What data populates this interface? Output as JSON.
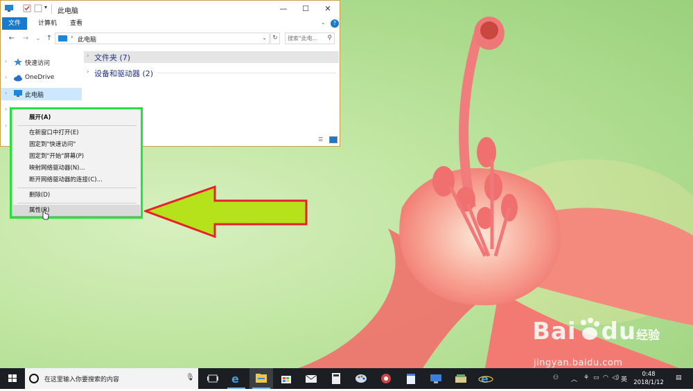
{
  "explorer": {
    "title": "此电脑",
    "tabs": [
      {
        "label": "文件",
        "active": true
      },
      {
        "label": "计算机",
        "active": false
      },
      {
        "label": "查看",
        "active": false
      }
    ],
    "address": {
      "path": "此电脑"
    },
    "search": {
      "placeholder": "搜索\"此电...",
      "icon": "search-icon"
    },
    "nav_pane": [
      {
        "label": "快速访问",
        "icon": "star-icon"
      },
      {
        "label": "OneDrive",
        "icon": "cloud-icon"
      },
      {
        "label": "此电脑",
        "icon": "computer-icon",
        "selected": true
      }
    ],
    "groups": [
      {
        "label": "文件夹 (7)"
      },
      {
        "label": "设备和驱动器 (2)"
      }
    ]
  },
  "context_menu": {
    "items": [
      {
        "label": "展开(A)",
        "bold": true
      },
      {
        "label": "在新窗口中打开(E)"
      },
      {
        "label": "固定到\"快速访问\""
      },
      {
        "label": "固定到\"开始\"屏幕(P)"
      },
      {
        "label": "映射网络驱动器(N)..."
      },
      {
        "label": "断开网络驱动器的连接(C)..."
      },
      {
        "label": "删除(D)"
      },
      {
        "label": "属性(R)",
        "hover": true
      }
    ]
  },
  "annotation": {
    "highlight_color": "#22e33c",
    "arrow_fill": "#b5e21a",
    "arrow_stroke": "#e8202a"
  },
  "watermark": {
    "logo_a": "Bai",
    "logo_b": "du",
    "logo_c": "经验",
    "url": "jingyan.baidu.com"
  },
  "taskbar": {
    "search_placeholder": "在这里输入你要搜索的内容",
    "apps": [
      "task-view-icon",
      "edge-icon",
      "file-explorer-icon",
      "store-icon",
      "mail-icon",
      "calculator-icon",
      "paint-icon",
      "photos-icon",
      "notepad-icon",
      "remote-icon",
      "folder-icon",
      "ie-icon"
    ],
    "tray": {
      "ime": "英"
    },
    "clock": {
      "time": "0:48",
      "date": "2018/1/12"
    }
  }
}
